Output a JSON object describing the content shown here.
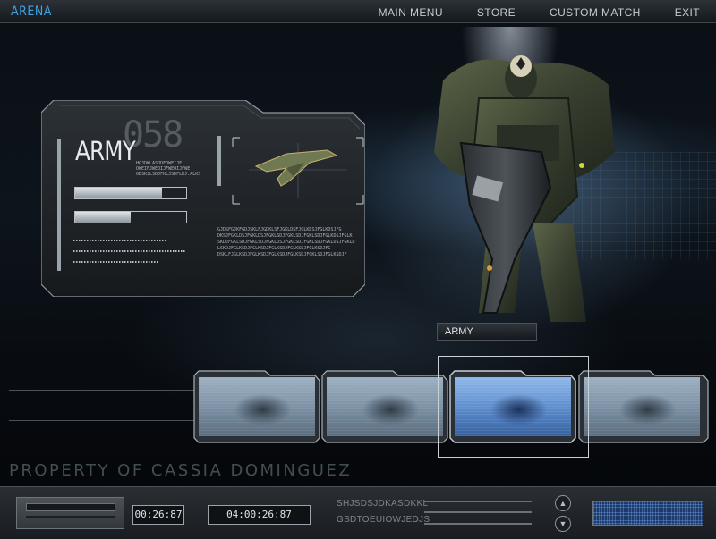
{
  "app": {
    "title": "ARENA"
  },
  "menu": {
    "items": [
      "MAIN MENU",
      "STORE",
      "CUSTOM MATCH",
      "EXIT"
    ]
  },
  "panel": {
    "name": "ARMY",
    "number": "058",
    "small_text": "HGJDKLASJDFOWEIJF\nOWEIFJWEOIJFWEOIJFWE\nODSKJLSDJFKLJSDFLKJ.ALKS",
    "desc_text": "GJDSFGJKFGDJSKLFJGDKLSFJGKLDSFJGLKDSJFGLKDSJFG\nDKSJFGKLDSJFGKLDSJFGKLSDJFGKLSDJFGKLSDJFGLKDSJFGLK\nSKDJFGKLSDJFGKLSDJFGKLDSJFGKLSDJFGKLSDJFGKLDSJFGKLD\nLSKDJFGLKSDJFGLKSDJFGLKSDJFGLKSDJFGLKSDJFG\nDSKLFJGLKSDJFGLKSDJFGLKSDJFGLKSDJFGKLSDJFGLKSDJF",
    "stats": [
      0.78,
      0.5
    ]
  },
  "selection": {
    "label": "ARMY"
  },
  "thumbnails": [
    {
      "selected": false
    },
    {
      "selected": false
    },
    {
      "selected": true
    },
    {
      "selected": false
    }
  ],
  "watermark": "PROPERTY OF CASSIA DOMINGUEZ",
  "bottom": {
    "timer1": "00:26:87",
    "timer2": "04:00:26:87",
    "code1": "SHJSDSJDKASDKKL",
    "code2": "GSDTOEUIOWJEDJS",
    "up_icon": "▲",
    "down_icon": "▼"
  },
  "icons": [
    "chevron-up-icon",
    "chevron-down-icon",
    "weapon-icon"
  ],
  "colors": {
    "accent": "#3fa4e6",
    "selected_thumb": "#5f8fd0"
  }
}
